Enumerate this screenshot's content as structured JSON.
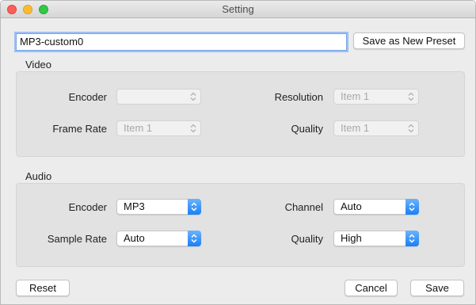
{
  "window": {
    "title": "Setting"
  },
  "preset": {
    "name_value": "MP3-custom0",
    "save_as_new_label": "Save as New Preset"
  },
  "video": {
    "section_label": "Video",
    "encoder_label": "Encoder",
    "encoder_value": "",
    "resolution_label": "Resolution",
    "resolution_value": "Item 1",
    "frame_rate_label": "Frame Rate",
    "frame_rate_value": "Item 1",
    "quality_label": "Quality",
    "quality_value": "Item 1"
  },
  "audio": {
    "section_label": "Audio",
    "encoder_label": "Encoder",
    "encoder_value": "MP3",
    "channel_label": "Channel",
    "channel_value": "Auto",
    "sample_rate_label": "Sample Rate",
    "sample_rate_value": "Auto",
    "quality_label": "Quality",
    "quality_value": "High"
  },
  "footer": {
    "reset_label": "Reset",
    "cancel_label": "Cancel",
    "save_label": "Save"
  },
  "colors": {
    "accent": "#1a7ff5",
    "close": "#fc5f57",
    "minimize": "#fdbc2e",
    "maximize": "#33c748"
  }
}
